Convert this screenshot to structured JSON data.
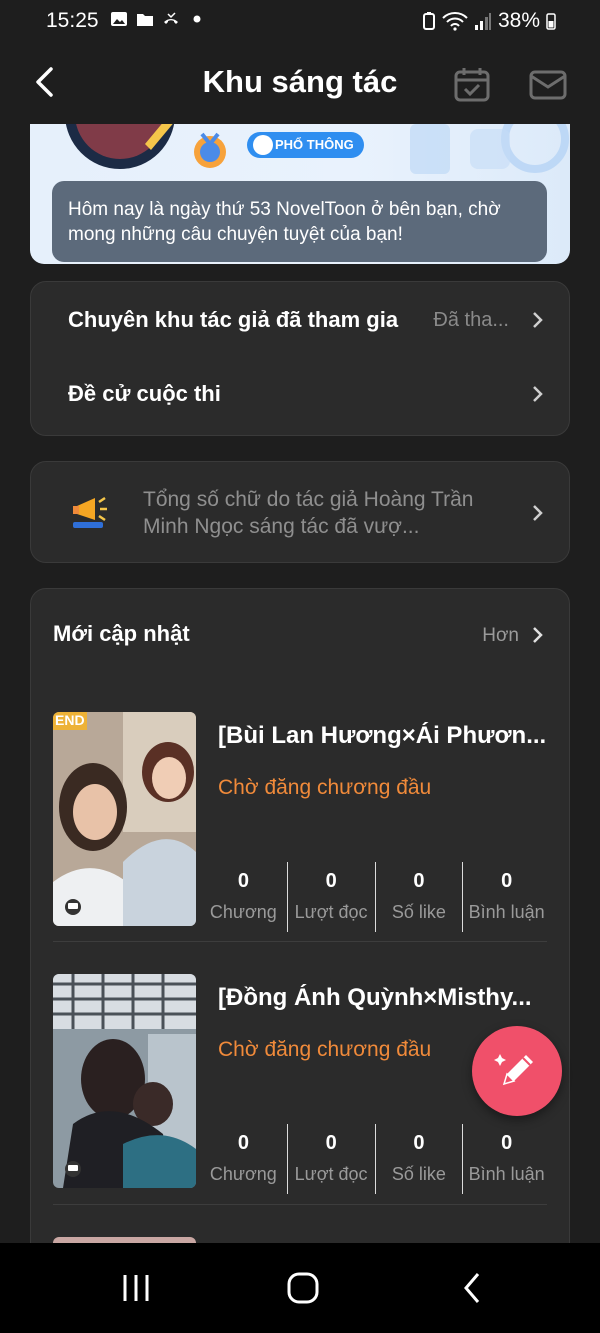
{
  "status_bar": {
    "time": "15:25",
    "battery": "38%"
  },
  "header": {
    "title": "Khu sáng tác"
  },
  "banner": {
    "tier": "PHỔ THÔNG",
    "message": "Hôm nay là ngày thứ 53 NovelToon ở bên bạn, chờ mong những câu chuyện tuyệt của bạn!"
  },
  "menu": [
    {
      "label": "Chuyên khu tác giả đã tham gia",
      "value": "Đã tha..."
    },
    {
      "label": "Đề cử cuộc thi",
      "value": ""
    }
  ],
  "notice": {
    "text": "Tổng số chữ do tác giả Hoàng Trần Minh Ngọc sáng tác đã vượ..."
  },
  "recent": {
    "title": "Mới cập nhật",
    "more": "Hơn",
    "stories": [
      {
        "title": "[Bùi Lan Hương×Ái Phươn...",
        "status": "Chờ đăng chương đầu",
        "thumb_tag": "END",
        "stats": [
          {
            "value": "0",
            "label": "Chương"
          },
          {
            "value": "0",
            "label": "Lượt đọc"
          },
          {
            "value": "0",
            "label": "Số like"
          },
          {
            "value": "0",
            "label": "Bình luận"
          }
        ]
      },
      {
        "title": "[Đồng Ánh Quỳnh×Misthy...",
        "status": "Chờ đăng chương đầu",
        "thumb_tag": "",
        "stats": [
          {
            "value": "0",
            "label": "Chương"
          },
          {
            "value": "0",
            "label": "Lượt đọc"
          },
          {
            "value": "0",
            "label": "Số like"
          },
          {
            "value": "0",
            "label": "Bình luận"
          }
        ]
      }
    ]
  },
  "colors": {
    "accent_orange": "#f08a3a",
    "fab_pink": "#f0506a",
    "badge_blue": "#2f8ef0"
  }
}
